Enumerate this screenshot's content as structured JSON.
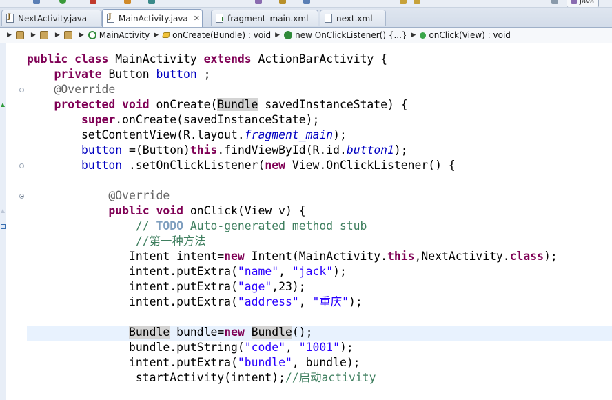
{
  "perspective": {
    "label": "Java"
  },
  "tabs": [
    {
      "label": "NextActivity.java",
      "type": "java",
      "active": false
    },
    {
      "label": "MainActivity.java",
      "type": "java",
      "active": true
    },
    {
      "label": "fragment_main.xml",
      "type": "xml",
      "active": false
    },
    {
      "label": "next.xml",
      "type": "xml",
      "active": false
    }
  ],
  "breadcrumb": {
    "class_name": "MainActivity",
    "method": "onCreate(Bundle) : void",
    "anonymous": "new OnClickListener() {...}",
    "inner_method": "onClick(View) : void"
  },
  "code_lines": [
    [
      [
        "kw",
        "public class "
      ],
      [
        "",
        "MainActivity "
      ],
      [
        "kw",
        "extends "
      ],
      [
        "",
        "ActionBarActivity {"
      ]
    ],
    [
      [
        "",
        "    "
      ],
      [
        "kw",
        "private "
      ],
      [
        "",
        "Button "
      ],
      [
        "fd",
        "button"
      ],
      [
        "",
        " ;"
      ]
    ],
    [
      [
        "",
        "    "
      ],
      [
        "an",
        "@Override"
      ]
    ],
    [
      [
        "",
        "    "
      ],
      [
        "kw",
        "protected void "
      ],
      [
        "",
        "onCreate("
      ],
      [
        "hl",
        "Bundle"
      ],
      [
        "",
        " savedInstanceState) {"
      ]
    ],
    [
      [
        "",
        "        "
      ],
      [
        "kw",
        "super"
      ],
      [
        "",
        ".onCreate(savedInstanceState);"
      ]
    ],
    [
      [
        "",
        "        setContentView(R.layout."
      ],
      [
        "it",
        "fragment_main"
      ],
      [
        "",
        ");"
      ]
    ],
    [
      [
        "",
        "        "
      ],
      [
        "fd",
        "button"
      ],
      [
        "",
        " =(Button)"
      ],
      [
        "kw",
        "this"
      ],
      [
        "",
        ".findViewById(R.id."
      ],
      [
        "it",
        "button1"
      ],
      [
        "",
        ");"
      ]
    ],
    [
      [
        "",
        "        "
      ],
      [
        "fd",
        "button"
      ],
      [
        "",
        " .setOnClickListener("
      ],
      [
        "kw",
        "new "
      ],
      [
        "",
        "View.OnClickListener() {"
      ]
    ],
    [
      [
        "",
        ""
      ]
    ],
    [
      [
        "",
        "            "
      ],
      [
        "an",
        "@Override"
      ]
    ],
    [
      [
        "",
        "            "
      ],
      [
        "kw",
        "public void "
      ],
      [
        "",
        "onClick(View v) {"
      ]
    ],
    [
      [
        "",
        "                "
      ],
      [
        "cm",
        "// "
      ],
      [
        "todo",
        "TODO"
      ],
      [
        "cm",
        " Auto-generated method stub"
      ]
    ],
    [
      [
        "",
        "                "
      ],
      [
        "cm",
        "//第一种方法"
      ]
    ],
    [
      [
        "",
        "               Intent intent="
      ],
      [
        "kw",
        "new "
      ],
      [
        "",
        "Intent(MainActivity."
      ],
      [
        "kw",
        "this"
      ],
      [
        "",
        ",NextActivity."
      ],
      [
        "kw",
        "class"
      ],
      [
        "",
        ");"
      ]
    ],
    [
      [
        "",
        "               intent.putExtra("
      ],
      [
        "st",
        "\"name\""
      ],
      [
        "",
        ", "
      ],
      [
        "st",
        "\"jack\""
      ],
      [
        "",
        ");"
      ]
    ],
    [
      [
        "",
        "               intent.putExtra("
      ],
      [
        "st",
        "\"age\""
      ],
      [
        "",
        ",23);"
      ]
    ],
    [
      [
        "",
        "               intent.putExtra("
      ],
      [
        "st",
        "\"address\""
      ],
      [
        "",
        ", "
      ],
      [
        "st",
        "\"重庆\""
      ],
      [
        "",
        ");"
      ]
    ],
    [
      [
        "",
        ""
      ]
    ],
    [
      [
        "",
        "               "
      ],
      [
        "hl",
        "Bundle"
      ],
      [
        "",
        " bundle="
      ],
      [
        "kw",
        "new "
      ],
      [
        "hl",
        "Bundle"
      ],
      [
        "",
        "();"
      ]
    ],
    [
      [
        "",
        "               bundle.putString("
      ],
      [
        "st",
        "\"code\""
      ],
      [
        "",
        ", "
      ],
      [
        "st",
        "\"1001\""
      ],
      [
        "",
        ");"
      ]
    ],
    [
      [
        "",
        "               intent.putExtra("
      ],
      [
        "st",
        "\"bundle\""
      ],
      [
        "",
        ", bundle);"
      ]
    ],
    [
      [
        "",
        "                startActivity(intent);"
      ],
      [
        "cm",
        "//启动activity"
      ]
    ]
  ]
}
